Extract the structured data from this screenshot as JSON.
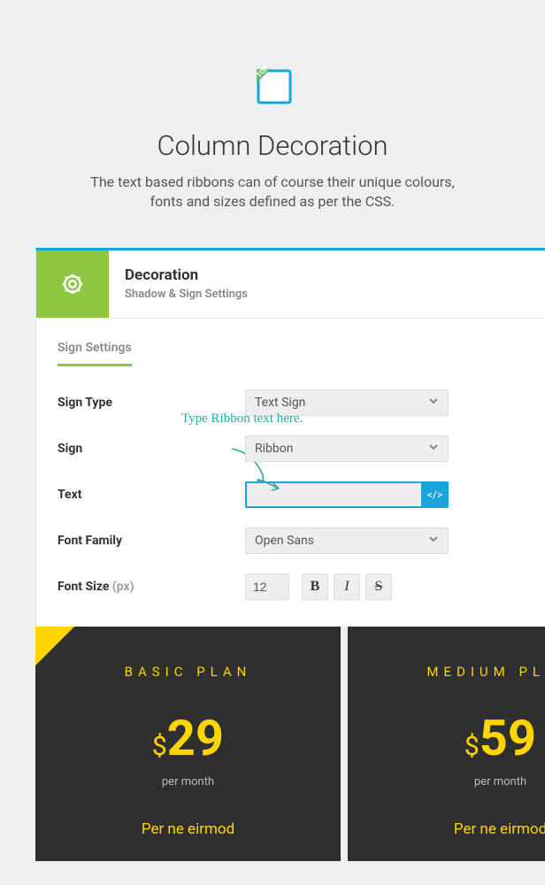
{
  "hero": {
    "icon_label": "TOP",
    "title": "Column Decoration",
    "subtitle_line1": "The text based ribbons can of course their unique colours,",
    "subtitle_line2": "fonts and sizes defined as per the CSS."
  },
  "panel": {
    "title": "Decoration",
    "subtitle": "Shadow & Sign Settings",
    "tab": "Sign Settings",
    "form": {
      "sign_type": {
        "label": "Sign Type",
        "value": "Text Sign"
      },
      "sign": {
        "label": "Sign",
        "value": "Ribbon"
      },
      "text": {
        "label": "Text",
        "value": ""
      },
      "font_family": {
        "label": "Font Family",
        "value": "Open Sans"
      },
      "font_size": {
        "label": "Font Size",
        "unit": "(px)",
        "value": "12"
      },
      "style_buttons": {
        "bold": "B",
        "italic": "I",
        "strike": "S"
      }
    },
    "annotation": "Type Ribbon text here."
  },
  "pricing": [
    {
      "name": "BASIC PLAN",
      "currency": "$",
      "price": "29",
      "period": "per month",
      "feature": "Per ne eirmod"
    },
    {
      "name": "MEDIUM PLAN",
      "currency": "$",
      "price": "59",
      "period": "per month",
      "feature": "Per ne eirmod"
    }
  ]
}
